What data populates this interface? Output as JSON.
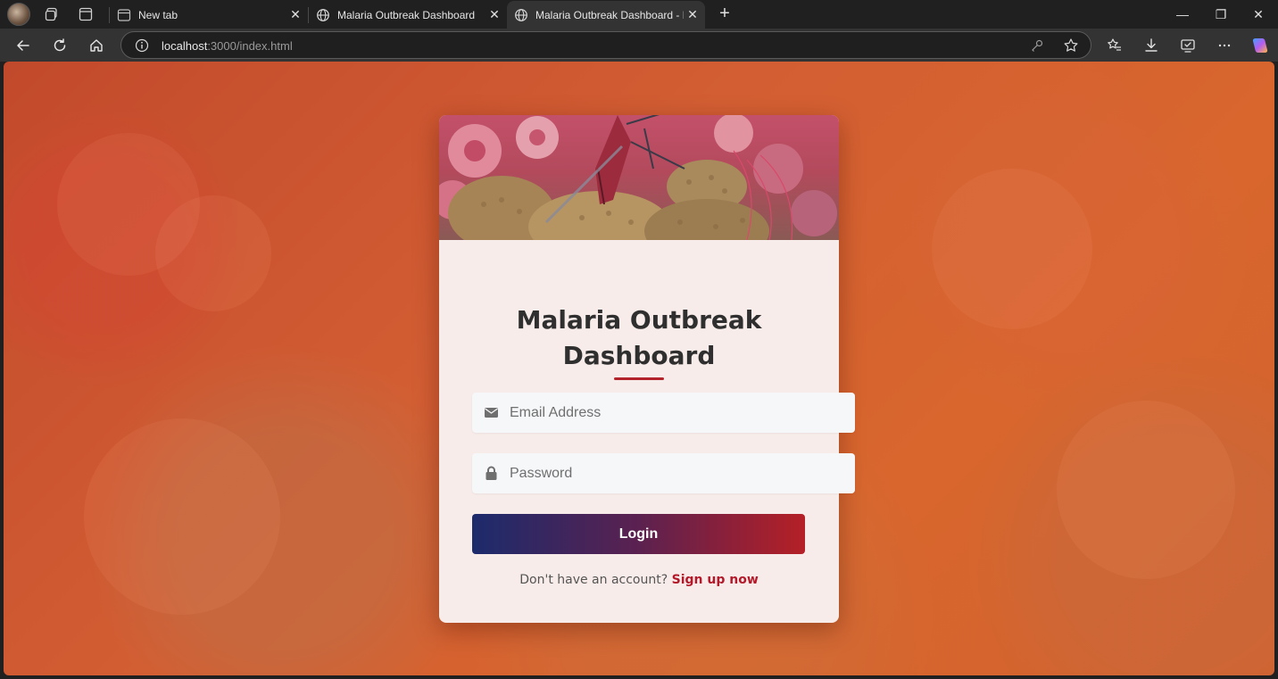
{
  "browser": {
    "tabs": [
      {
        "title": "New tab",
        "close": "✕"
      },
      {
        "title": "Malaria Outbreak Dashboard",
        "close": "✕"
      },
      {
        "title": "Malaria Outbreak Dashboard - Lo",
        "close": "✕"
      }
    ],
    "new_tab": "+",
    "window_controls": {
      "minimize": "—",
      "restore": "❐",
      "close": "✕"
    },
    "url_host": "localhost",
    "url_rest": ":3000/index.html"
  },
  "login": {
    "heading_line1": "Malaria Outbreak",
    "heading_line2": "Dashboard",
    "email_placeholder": "Email Address",
    "password_placeholder": "Password",
    "login_label": "Login",
    "signup_prompt": "Don't have an account?",
    "signup_link": "Sign up now"
  },
  "colors": {
    "accent_red": "#b3232b",
    "button_gradient_start": "#1c2b6c",
    "button_gradient_end": "#b52026",
    "card_background": "#f7ece9"
  }
}
